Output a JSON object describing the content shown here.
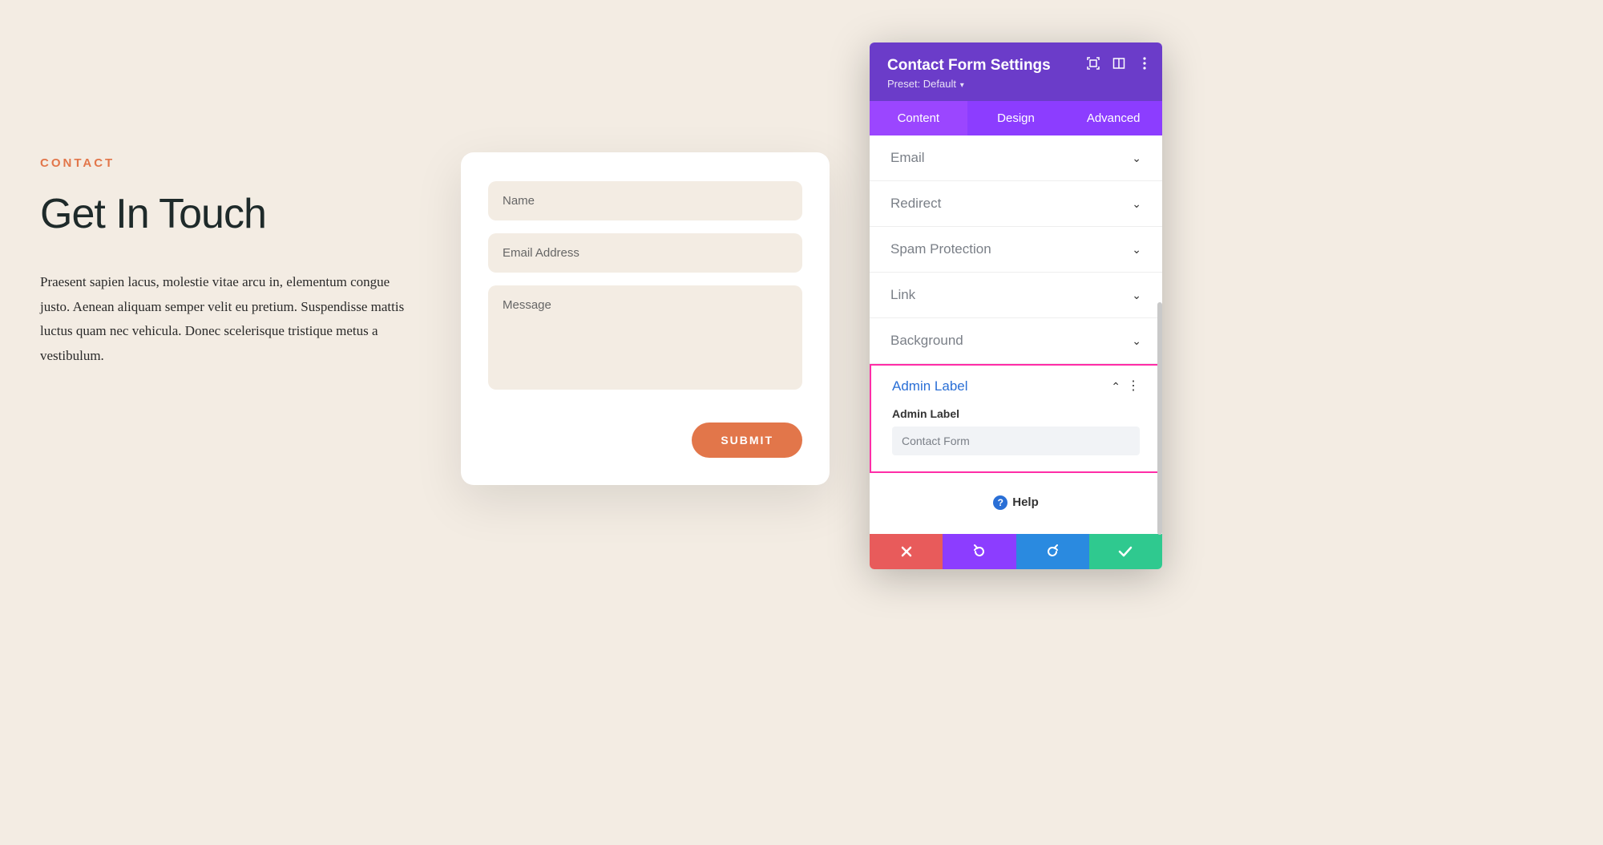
{
  "page": {
    "eyebrow": "CONTACT",
    "title": "Get In Touch",
    "description": "Praesent sapien lacus, molestie vitae arcu in, elementum congue justo. Aenean aliquam semper velit eu pretium. Suspendisse mattis luctus quam nec vehicula. Donec scelerisque tristique metus a vestibulum."
  },
  "form": {
    "name_placeholder": "Name",
    "email_placeholder": "Email Address",
    "message_placeholder": "Message",
    "submit_label": "SUBMIT"
  },
  "panel": {
    "title": "Contact Form Settings",
    "preset_prefix": "Preset: ",
    "preset_value": "Default",
    "tabs": [
      "Content",
      "Design",
      "Advanced"
    ],
    "active_tab": 0,
    "sections": [
      {
        "label": "Email",
        "open": false
      },
      {
        "label": "Redirect",
        "open": false
      },
      {
        "label": "Spam Protection",
        "open": false
      },
      {
        "label": "Link",
        "open": false
      },
      {
        "label": "Background",
        "open": false
      }
    ],
    "admin_label_section": {
      "header": "Admin Label",
      "field_label": "Admin Label",
      "field_value": "Contact Form"
    },
    "help_label": "Help"
  }
}
